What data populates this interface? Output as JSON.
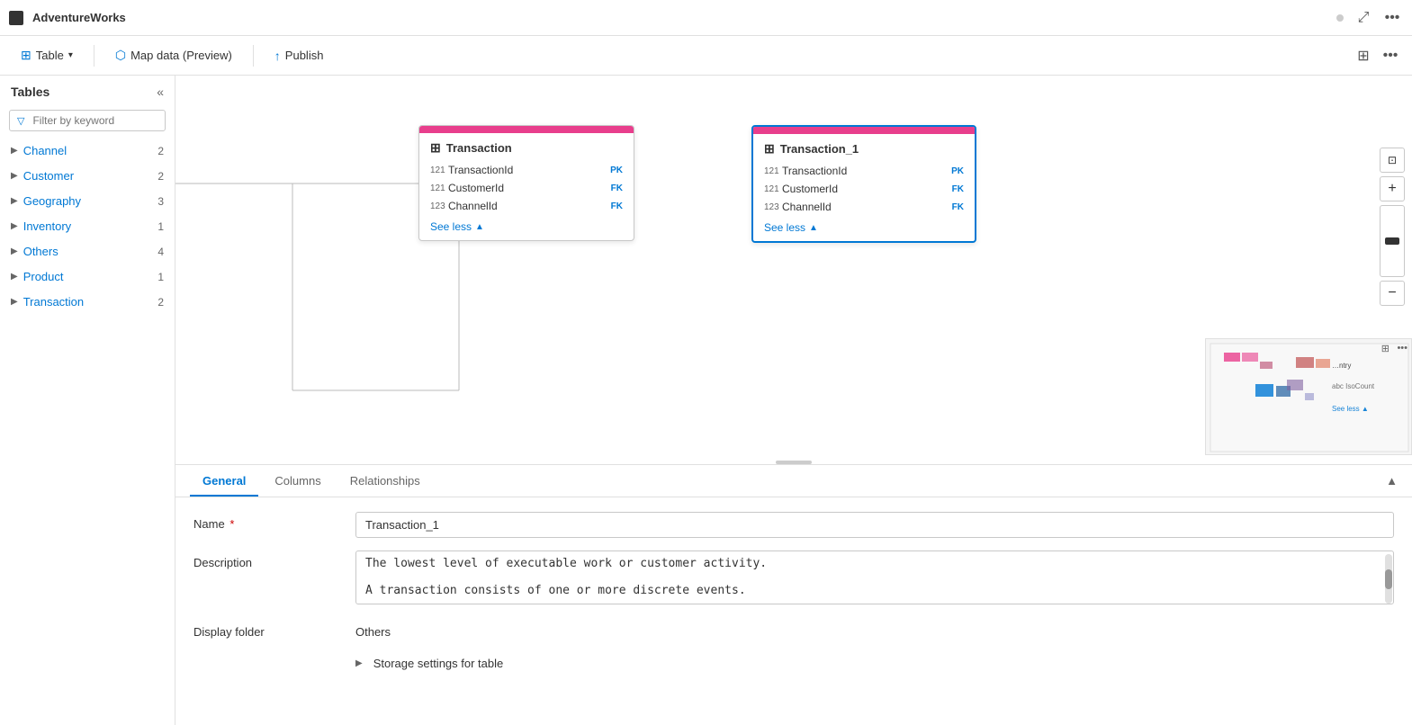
{
  "app": {
    "title": "AdventureWorks",
    "dot_color": "#aaa"
  },
  "toolbar": {
    "table_label": "Table",
    "map_data_label": "Map data (Preview)",
    "publish_label": "Publish"
  },
  "sidebar": {
    "title": "Tables",
    "filter_placeholder": "Filter by keyword",
    "items": [
      {
        "name": "Channel",
        "count": 2
      },
      {
        "name": "Customer",
        "count": 2
      },
      {
        "name": "Geography",
        "count": 3
      },
      {
        "name": "Inventory",
        "count": 1
      },
      {
        "name": "Others",
        "count": 4
      },
      {
        "name": "Product",
        "count": 1
      },
      {
        "name": "Transaction",
        "count": 2
      }
    ]
  },
  "canvas": {
    "transaction_card": {
      "title": "Transaction",
      "fields": [
        {
          "type": "121",
          "name": "TransactionId",
          "badge": "PK"
        },
        {
          "type": "121",
          "name": "CustomerId",
          "badge": "FK"
        },
        {
          "type": "123",
          "name": "ChannelId",
          "badge": "FK"
        }
      ],
      "see_less": "See less"
    },
    "transaction1_card": {
      "title": "Transaction_1",
      "fields": [
        {
          "type": "121",
          "name": "TransactionId",
          "badge": "PK"
        },
        {
          "type": "121",
          "name": "CustomerId",
          "badge": "FK"
        },
        {
          "type": "123",
          "name": "ChannelId",
          "badge": "FK"
        }
      ],
      "see_less": "See less"
    }
  },
  "zoom_controls": {
    "fit_icon": "⊡",
    "plus_icon": "+",
    "minus_icon": "−",
    "more_icon": "⋯"
  },
  "bottom_panel": {
    "tabs": [
      {
        "label": "General",
        "active": true
      },
      {
        "label": "Columns",
        "active": false
      },
      {
        "label": "Relationships",
        "active": false
      }
    ],
    "form": {
      "name_label": "Name",
      "name_required": true,
      "name_value": "Transaction_1",
      "description_label": "Description",
      "description_line1": "The lowest level of executable work or customer activity.",
      "description_line2": "A transaction consists of one or more discrete events.",
      "display_folder_label": "Display folder",
      "display_folder_value": "Others",
      "storage_label": "Storage settings for table"
    }
  },
  "minimap": {
    "colors": [
      "#e83e8c",
      "#c0c0e0",
      "#0078d4",
      "#e06060",
      "#a0a0c0"
    ]
  }
}
